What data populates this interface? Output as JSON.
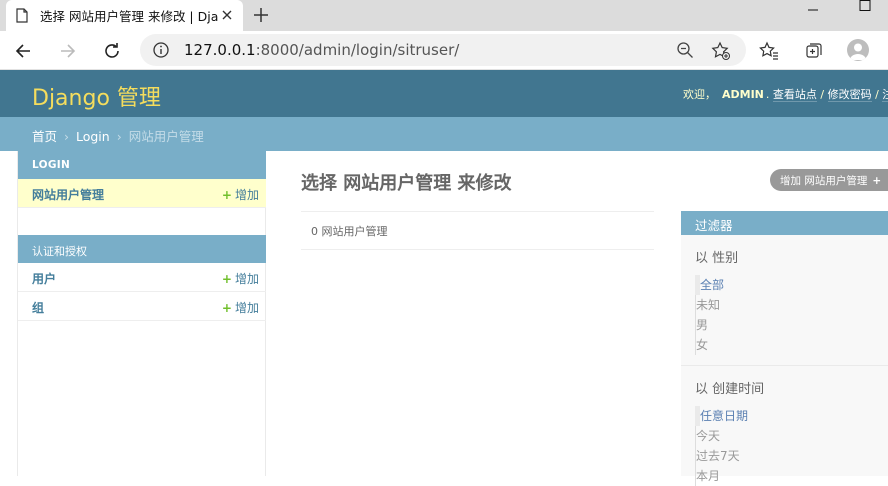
{
  "browser": {
    "tab_title": "选择 网站用户管理 来修改 | Django",
    "url_host": "127.0.0.1",
    "url_rest": ":8000/admin/login/sitruser/"
  },
  "header": {
    "branding": "Django 管理",
    "welcome": "欢迎，",
    "username": "ADMIN",
    "view_site": "查看站点",
    "sep1": " / ",
    "change_password": "修改密码",
    "sep2": " / ",
    "logout": "注销"
  },
  "breadcrumbs": {
    "home": "首页",
    "app": "Login",
    "current": "网站用户管理",
    "separator": "›"
  },
  "sidebar": {
    "modules": [
      {
        "caption": "LOGIN",
        "rows": [
          {
            "name": "网站用户管理",
            "add": "增加"
          }
        ]
      },
      {
        "caption": "认证和授权",
        "rows": [
          {
            "name": "用户",
            "add": "增加"
          },
          {
            "name": "组",
            "add": "增加"
          }
        ]
      }
    ],
    "add_plus": "+"
  },
  "content": {
    "title": "选择 网站用户管理 来修改",
    "add_button": "增加 网站用户管理",
    "add_plus": "+",
    "paginator": "0 网站用户管理"
  },
  "filter": {
    "title": "过滤器",
    "groups": [
      {
        "heading": "以 性别",
        "options": [
          "全部",
          "未知",
          "男",
          "女"
        ]
      },
      {
        "heading": "以 创建时间",
        "options": [
          "任意日期",
          "今天",
          "过去7天",
          "本月"
        ]
      }
    ]
  },
  "colors": {
    "header_bg": "#417690",
    "branding": "#f5dd5d",
    "breadcrumbs_bg": "#79aec8",
    "link": "#447e9b",
    "selected_row": "#ffffcc",
    "add_green": "#70bf2b"
  }
}
